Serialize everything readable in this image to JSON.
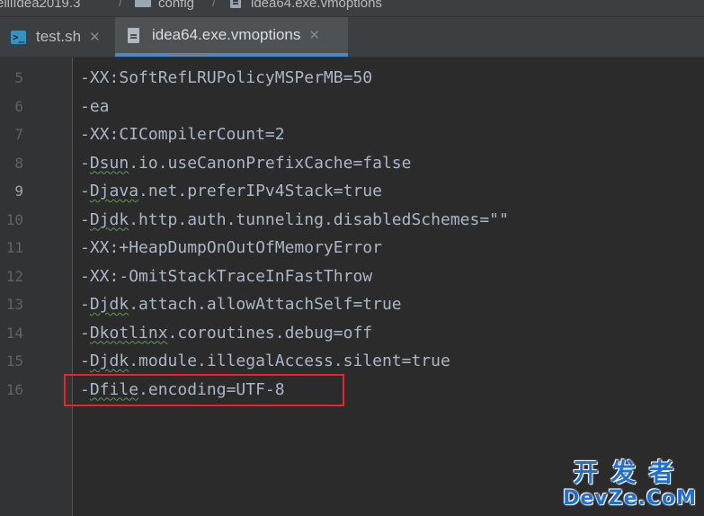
{
  "breadcrumb": {
    "project": "elliIdea2019.3",
    "folder": "config",
    "file": "idea64.exe.vmoptions"
  },
  "tabs": [
    {
      "label": "test.sh",
      "icon": "shell-script-icon",
      "active": false
    },
    {
      "label": "idea64.exe.vmoptions",
      "icon": "file-icon",
      "active": true
    }
  ],
  "editor": {
    "current_line": 9,
    "lines": [
      {
        "no": "5",
        "pre": "-",
        "sq": "",
        "post": "XX:SoftRefLRUPolicyMSPerMB=50"
      },
      {
        "no": "6",
        "pre": "-",
        "sq": "",
        "post": "ea"
      },
      {
        "no": "7",
        "pre": "-",
        "sq": "",
        "post": "XX:CICompilerCount=2"
      },
      {
        "no": "8",
        "pre": "-",
        "sq": "Dsun",
        "post": ".io.useCanonPrefixCache=false"
      },
      {
        "no": "9",
        "pre": "-",
        "sq": "Djava",
        "post": ".net.preferIPv4Stack=true"
      },
      {
        "no": "10",
        "pre": "-",
        "sq": "Djdk",
        "post": ".http.auth.tunneling.disabledSchemes=\"\""
      },
      {
        "no": "11",
        "pre": "-",
        "sq": "",
        "post": "XX:+HeapDumpOnOutOfMemoryError"
      },
      {
        "no": "12",
        "pre": "-",
        "sq": "",
        "post": "XX:-OmitStackTraceInFastThrow"
      },
      {
        "no": "13",
        "pre": "-",
        "sq": "Djdk",
        "post": ".attach.allowAttachSelf=true"
      },
      {
        "no": "14",
        "pre": "-",
        "sq": "Dkotlinx",
        "post": ".coroutines.debug=off"
      },
      {
        "no": "15",
        "pre": "-",
        "sq": "Djdk",
        "post": ".module.illegalAccess.silent=true"
      },
      {
        "no": "16",
        "pre": "-",
        "sq": "Dfile",
        "post": ".encoding=UTF-8"
      }
    ]
  },
  "colors": {
    "background": "#2b2b2b",
    "tab_underline": "#4a88c7",
    "highlight_box": "#e8232a",
    "watermark": "#1f6fd8"
  },
  "watermark": {
    "top": "开发者",
    "bottom": "DevZe.CoM"
  }
}
